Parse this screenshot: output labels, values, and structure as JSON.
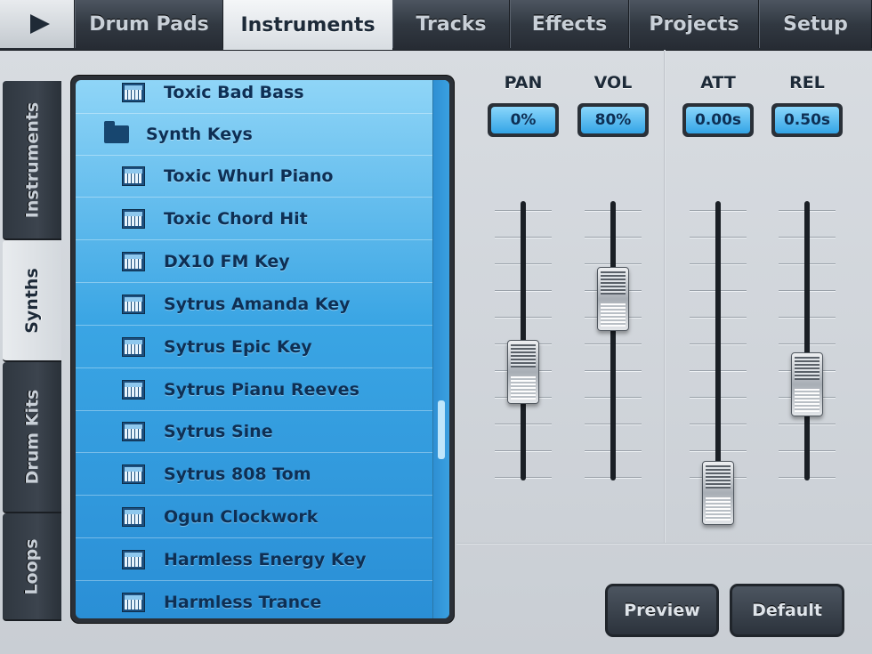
{
  "topbar": {
    "play_label": "play",
    "tabs": [
      {
        "label": "Drum Pads"
      },
      {
        "label": "Instruments"
      },
      {
        "label": "Tracks"
      },
      {
        "label": "Effects"
      },
      {
        "label": "Projects"
      },
      {
        "label": "Setup"
      }
    ],
    "active_tab": "Instruments"
  },
  "categories": [
    {
      "label": "Instruments"
    },
    {
      "label": "Synths"
    },
    {
      "label": "Drum Kits"
    },
    {
      "label": "Loops"
    }
  ],
  "active_category": "Synths",
  "list": {
    "items": [
      {
        "label": "Toxic Bad Bass",
        "kind": "instrument"
      },
      {
        "label": "Synth Keys",
        "kind": "folder"
      },
      {
        "label": "Toxic Whurl Piano",
        "kind": "instrument"
      },
      {
        "label": "Toxic Chord Hit",
        "kind": "instrument"
      },
      {
        "label": "DX10 FM Key",
        "kind": "instrument"
      },
      {
        "label": "Sytrus Amanda Key",
        "kind": "instrument"
      },
      {
        "label": "Sytrus Epic Key",
        "kind": "instrument"
      },
      {
        "label": "Sytrus Pianu Reeves",
        "kind": "instrument"
      },
      {
        "label": "Sytrus Sine",
        "kind": "instrument"
      },
      {
        "label": "Sytrus 808 Tom",
        "kind": "instrument"
      },
      {
        "label": "Ogun Clockwork",
        "kind": "instrument"
      },
      {
        "label": "Harmless Energy Key",
        "kind": "instrument"
      },
      {
        "label": "Harmless Trance",
        "kind": "instrument"
      }
    ]
  },
  "mixer": {
    "controls": [
      {
        "label": "PAN",
        "value": "0%",
        "fader_level": 0.5
      },
      {
        "label": "VOL",
        "value": "80%",
        "fader_level": 0.8
      },
      {
        "label": "ATT",
        "value": "0.00s",
        "fader_level": 0.0
      },
      {
        "label": "REL",
        "value": "0.50s",
        "fader_level": 0.45
      }
    ]
  },
  "buttons": {
    "preview": "Preview",
    "default": "Default"
  },
  "colors": {
    "list_blue": "#3aa5e4",
    "readout_blue": "#33a4e6",
    "dark_chrome": "#313841"
  }
}
